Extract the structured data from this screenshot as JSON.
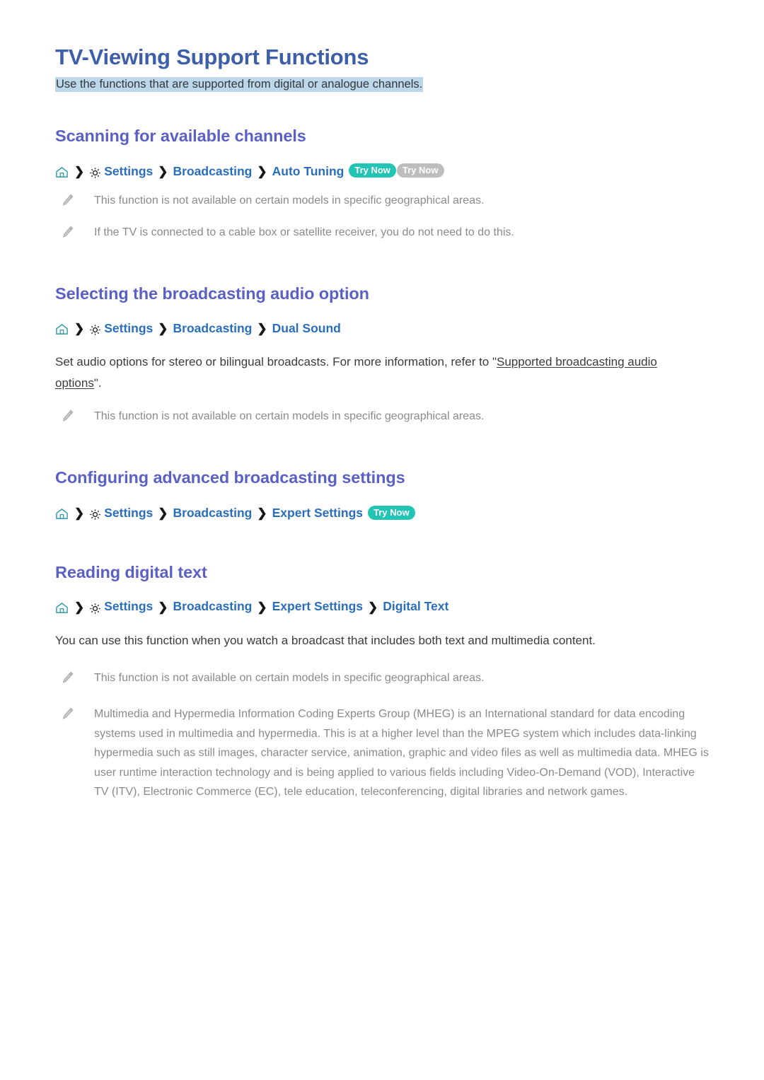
{
  "document": {
    "title": "TV-Viewing Support Functions",
    "subtitle": "Use the functions that are supported from digital or analogue channels.",
    "subtitle_highlight_color": "#bcd6ea",
    "title_color": "#3c5fa8",
    "heading_color": "#5a60c4",
    "link_color": "#2a6ebb",
    "badge_teal_color": "#22c4b4",
    "badge_grey_color": "#bdbdbd"
  },
  "sections": [
    {
      "heading": "Scanning for available channels",
      "breadcrumb": {
        "home_icon": "home-icon",
        "gear_icon": "gear-icon",
        "separator": "❯",
        "items": [
          "Settings",
          "Broadcasting",
          "Auto Tuning"
        ],
        "badges": [
          {
            "label": "Try Now",
            "style": "teal"
          },
          {
            "label": "Try Now",
            "style": "grey"
          }
        ]
      },
      "notes": [
        "This function is not available on certain models in specific geographical areas.",
        "If the TV is connected to a cable box or satellite receiver, you do not need to do this."
      ]
    },
    {
      "heading": "Selecting the broadcasting audio option",
      "breadcrumb": {
        "home_icon": "home-icon",
        "gear_icon": "gear-icon",
        "separator": "❯",
        "items": [
          "Settings",
          "Broadcasting",
          "Dual Sound"
        ],
        "badges": []
      },
      "paragraph": {
        "before_link": "Set audio options for stereo or bilingual broadcasts. For more information, refer to \"",
        "link": "Supported broadcasting audio options",
        "after_link": "\"."
      },
      "notes": [
        "This function is not available on certain models in specific geographical areas."
      ]
    },
    {
      "heading": "Configuring advanced broadcasting settings",
      "breadcrumb": {
        "home_icon": "home-icon",
        "gear_icon": "gear-icon",
        "separator": "❯",
        "items": [
          "Settings",
          "Broadcasting",
          "Expert Settings"
        ],
        "badges": [
          {
            "label": "Try Now",
            "style": "teal"
          }
        ]
      },
      "notes": []
    },
    {
      "heading": "Reading digital text",
      "breadcrumb": {
        "home_icon": "home-icon",
        "gear_icon": "gear-icon",
        "separator": "❯",
        "items": [
          "Settings",
          "Broadcasting",
          "Expert Settings",
          "Digital Text"
        ],
        "badges": []
      },
      "paragraph_plain": "You can use this function when you watch a broadcast that includes both text and multimedia content.",
      "notes": [
        "This function is not available on certain models in specific geographical areas.",
        "Multimedia and Hypermedia Information Coding Experts Group (MHEG) is an International standard for data encoding systems used in multimedia and hypermedia. This is at a higher level than the MPEG system which includes data-linking hypermedia such as still images, character service, animation, graphic and video files as well as multimedia data. MHEG is user runtime interaction technology and is being applied to various fields including Video-On-Demand (VOD), Interactive TV (ITV), Electronic Commerce (EC), tele education, teleconferencing, digital libraries and network games."
      ]
    }
  ]
}
